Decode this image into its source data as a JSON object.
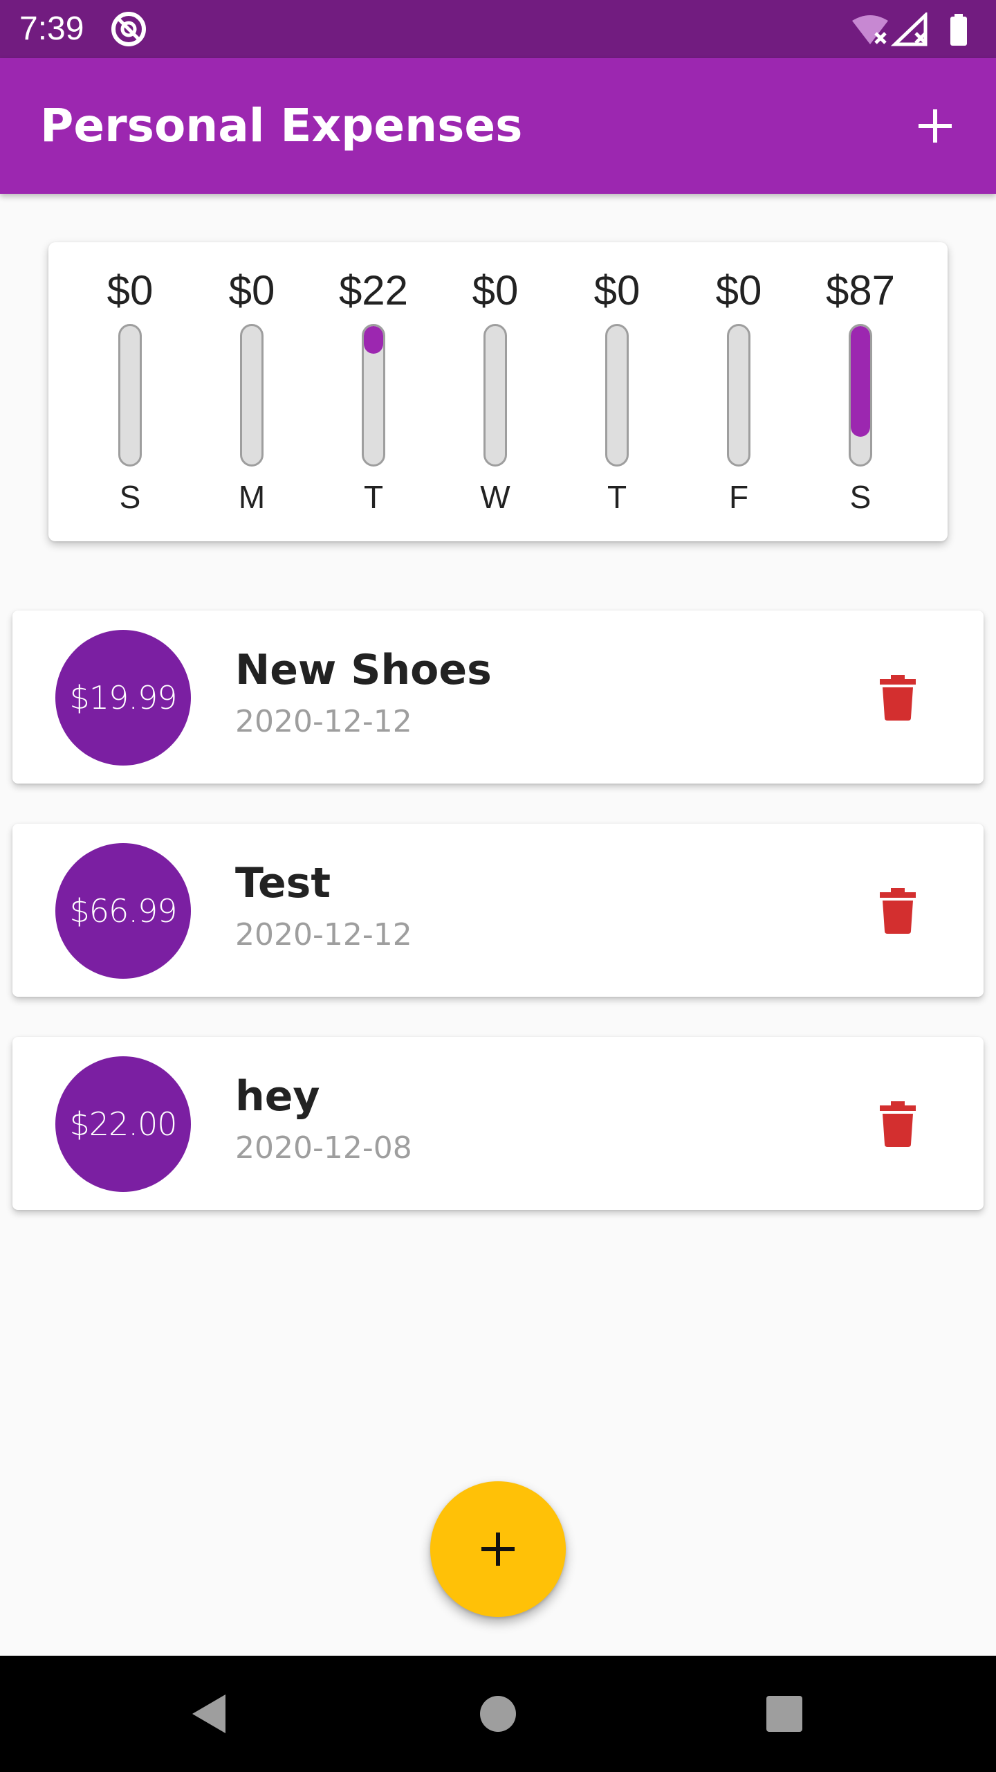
{
  "status_bar": {
    "time": "7:39",
    "app_icon": "data-saver-icon",
    "icons": [
      "wifi-off-icon",
      "signal-off-icon",
      "battery-full-icon"
    ]
  },
  "app_bar": {
    "title": "Personal Expenses",
    "add_icon": "plus-icon"
  },
  "chart": {
    "days": [
      {
        "day": "S",
        "amount": "$0",
        "fill": 0.0
      },
      {
        "day": "M",
        "amount": "$0",
        "fill": 0.0
      },
      {
        "day": "T",
        "amount": "$22",
        "fill": 0.2
      },
      {
        "day": "W",
        "amount": "$0",
        "fill": 0.0
      },
      {
        "day": "T",
        "amount": "$0",
        "fill": 0.0
      },
      {
        "day": "F",
        "amount": "$0",
        "fill": 0.0
      },
      {
        "day": "S",
        "amount": "$87",
        "fill": 0.8
      }
    ],
    "colors": {
      "fill": "#9c27b0",
      "track": "#dedede",
      "border": "#9e9e9e"
    }
  },
  "transactions": [
    {
      "amount": "$19.99",
      "title": "New Shoes",
      "date": "2020-12-12",
      "delete_icon": "trash-icon"
    },
    {
      "amount": "$66.99",
      "title": "Test",
      "date": "2020-12-12",
      "delete_icon": "trash-icon"
    },
    {
      "amount": "$22.00",
      "title": "hey",
      "date": "2020-12-08",
      "delete_icon": "trash-icon"
    }
  ],
  "fab": {
    "icon": "plus-icon",
    "color": "#ffc107"
  },
  "nav_bar": {
    "buttons": [
      "back-icon",
      "home-icon",
      "recents-icon"
    ]
  },
  "colors": {
    "primary": "#9c27b0",
    "primary_dark": "#721c80",
    "avatar": "#7b1fa2",
    "delete": "#d32f2f",
    "background": "#fafafa"
  }
}
